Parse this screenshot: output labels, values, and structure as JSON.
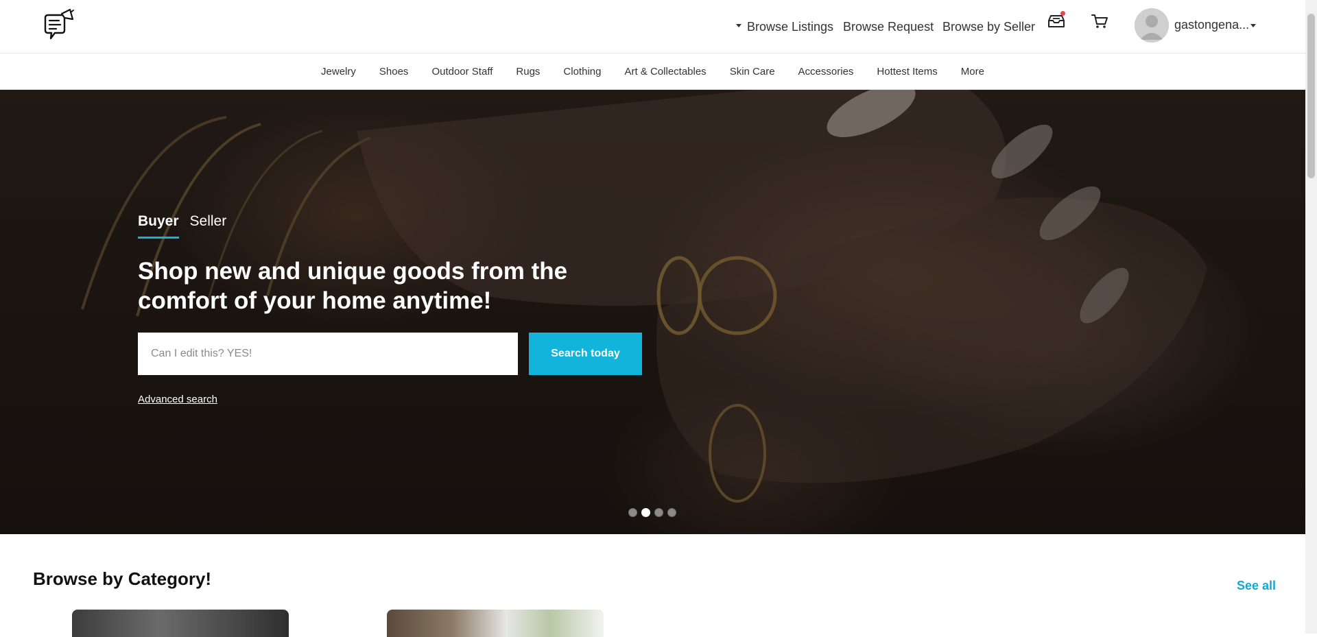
{
  "header": {
    "browse_listings": "Browse Listings",
    "browse_request": "Browse Request",
    "browse_by_seller": "Browse by Seller",
    "username": "gastongena...",
    "notification_dot_color": "#e5484d"
  },
  "category_nav": {
    "items": [
      "Jewelry",
      "Shoes",
      "Outdoor Staff",
      "Rugs",
      "Clothing",
      "Art & Collectables",
      "Skin Care",
      "Accessories",
      "Hottest Items",
      "More"
    ]
  },
  "hero": {
    "tabs": [
      {
        "label": "Buyer",
        "active": true
      },
      {
        "label": "Seller",
        "active": false
      }
    ],
    "headline": "Shop new and unique goods from the comfort of your home anytime!",
    "search_placeholder": "Can I edit this? YES!",
    "search_button": "Search today",
    "advanced_search": "Advanced search",
    "carousel": {
      "count": 4,
      "active_index": 1
    }
  },
  "browse_category": {
    "title": "Browse by Category!",
    "see_all": "See all"
  },
  "colors": {
    "accent": "#12b4dc",
    "see_all": "#12a9d0"
  }
}
